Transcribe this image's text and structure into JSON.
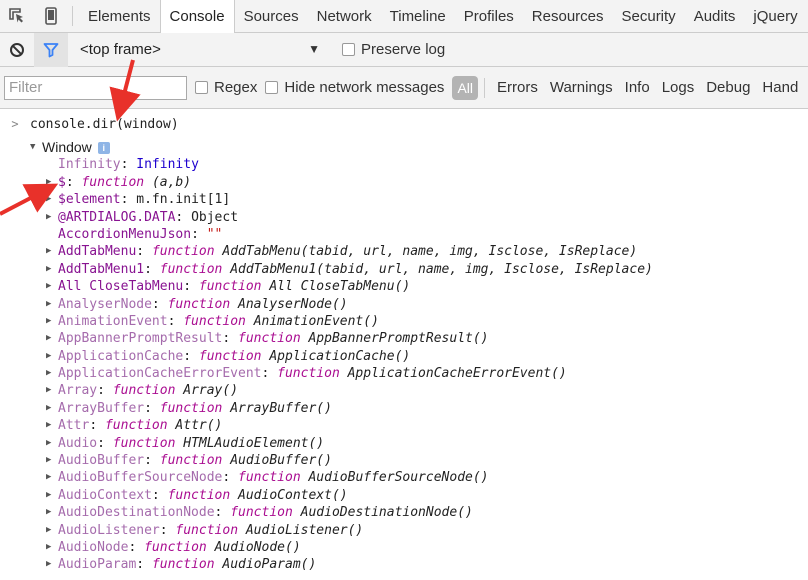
{
  "tabs": [
    "Elements",
    "Console",
    "Sources",
    "Network",
    "Timeline",
    "Profiles",
    "Resources",
    "Security",
    "Audits",
    "jQuery"
  ],
  "active_tab": "Console",
  "toolbar": {
    "frame_selector": "<top frame>",
    "preserve_log_label": "Preserve log"
  },
  "filterbar": {
    "filter_placeholder": "Filter",
    "regex_label": "Regex",
    "hide_network_label": "Hide network messages",
    "all_label": "All",
    "levels": [
      "Errors",
      "Warnings",
      "Info",
      "Logs",
      "Debug",
      "Hand"
    ]
  },
  "console": {
    "command": "console.dir(window)",
    "root_label": "Window",
    "rows": [
      {
        "key": "Infinity",
        "own": false,
        "expandable": false,
        "type": "number",
        "value": "Infinity"
      },
      {
        "key": "$",
        "own": true,
        "expandable": true,
        "type": "function",
        "value": "(a,b)"
      },
      {
        "key": "$element",
        "own": true,
        "expandable": true,
        "type": "object",
        "value": "m.fn.init[1]"
      },
      {
        "key": "@ARTDIALOG.DATA",
        "own": true,
        "expandable": true,
        "type": "object",
        "value": "Object"
      },
      {
        "key": "AccordionMenuJson",
        "own": true,
        "expandable": false,
        "type": "string",
        "value": "\"\""
      },
      {
        "key": "AddTabMenu",
        "own": true,
        "expandable": true,
        "type": "function",
        "value": "AddTabMenu(tabid, url, name, img, Isclose, IsReplace)"
      },
      {
        "key": "AddTabMenu1",
        "own": true,
        "expandable": true,
        "type": "function",
        "value": "AddTabMenu1(tabid, url, name, img, Isclose, IsReplace)"
      },
      {
        "key": "All CloseTabMenu",
        "own": true,
        "expandable": true,
        "type": "function",
        "value": "All CloseTabMenu()"
      },
      {
        "key": "AnalyserNode",
        "own": false,
        "expandable": true,
        "type": "function",
        "value": "AnalyserNode()"
      },
      {
        "key": "AnimationEvent",
        "own": false,
        "expandable": true,
        "type": "function",
        "value": "AnimationEvent()"
      },
      {
        "key": "AppBannerPromptResult",
        "own": false,
        "expandable": true,
        "type": "function",
        "value": "AppBannerPromptResult()"
      },
      {
        "key": "ApplicationCache",
        "own": false,
        "expandable": true,
        "type": "function",
        "value": "ApplicationCache()"
      },
      {
        "key": "ApplicationCacheErrorEvent",
        "own": false,
        "expandable": true,
        "type": "function",
        "value": "ApplicationCacheErrorEvent()"
      },
      {
        "key": "Array",
        "own": false,
        "expandable": true,
        "type": "function",
        "value": "Array()"
      },
      {
        "key": "ArrayBuffer",
        "own": false,
        "expandable": true,
        "type": "function",
        "value": "ArrayBuffer()"
      },
      {
        "key": "Attr",
        "own": false,
        "expandable": true,
        "type": "function",
        "value": "Attr()"
      },
      {
        "key": "Audio",
        "own": false,
        "expandable": true,
        "type": "function",
        "value": "HTMLAudioElement()"
      },
      {
        "key": "AudioBuffer",
        "own": false,
        "expandable": true,
        "type": "function",
        "value": "AudioBuffer()"
      },
      {
        "key": "AudioBufferSourceNode",
        "own": false,
        "expandable": true,
        "type": "function",
        "value": "AudioBufferSourceNode()"
      },
      {
        "key": "AudioContext",
        "own": false,
        "expandable": true,
        "type": "function",
        "value": "AudioContext()"
      },
      {
        "key": "AudioDestinationNode",
        "own": false,
        "expandable": true,
        "type": "function",
        "value": "AudioDestinationNode()"
      },
      {
        "key": "AudioListener",
        "own": false,
        "expandable": true,
        "type": "function",
        "value": "AudioListener()"
      },
      {
        "key": "AudioNode",
        "own": false,
        "expandable": true,
        "type": "function",
        "value": "AudioNode()"
      },
      {
        "key": "AudioParam",
        "own": false,
        "expandable": true,
        "type": "function",
        "value": "AudioParam()"
      }
    ],
    "function_keyword": "function"
  },
  "colors": {
    "own_key": "#881391",
    "inherited_key": "#a56bac",
    "keyword": "#aa0d91",
    "number": "#1c00cf",
    "string": "#c41a16",
    "annotation_arrow": "#e8312a",
    "active_filter_icon": "#3b82f6"
  }
}
